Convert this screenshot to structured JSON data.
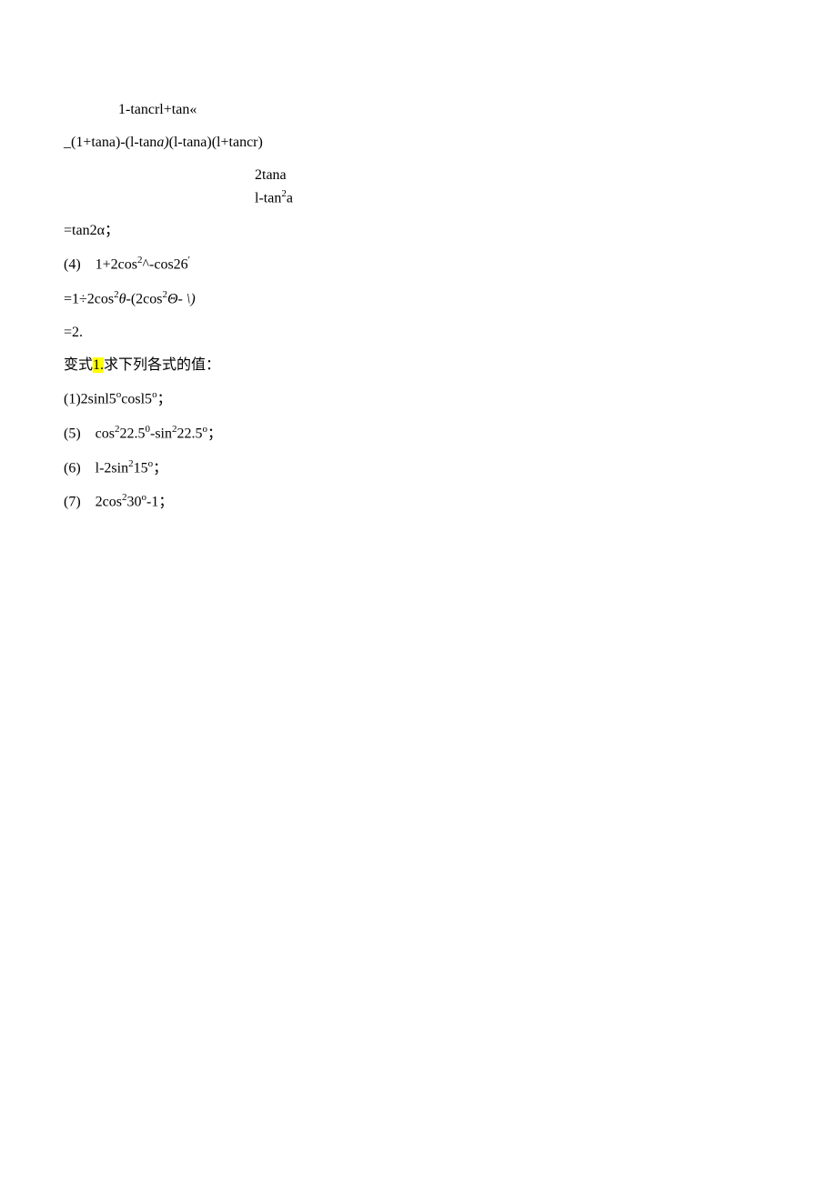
{
  "lines": {
    "l1": "1-tancrl+tan«",
    "l2_pre": "_(1+tana)-(l-tan",
    "l2_a": "a)",
    "l2_post": "(l-tana)(l+tancr)",
    "l3": "2tana",
    "l4a": "l-tan",
    "l4b": "2",
    "l4c": "a",
    "l5": "=tan2α；",
    "l6a": "(4)    1+2cos",
    "l6b": "2",
    "l6c": "^-cos26",
    "l6d": "'",
    "l7a": "=1÷2cos",
    "l7b": "2",
    "l7c": "θ",
    "l7d": "-(2cos",
    "l7e": "2",
    "l7f": "Θ-",
    "l7g": " \\)",
    "l8": "=2.",
    "l9a": "变式",
    "l9b": "1.",
    "l9c": "求下列各式的值：",
    "l10a": "(1)2sinl5",
    "l10b": "o",
    "l10c": "cosl5",
    "l10d": "o",
    "l10e": "；",
    "l11a": "(5)    cos",
    "l11b": "2",
    "l11c": "22.5",
    "l11d": "0",
    "l11e": "-sin",
    "l11f": "2",
    "l11g": "22.5",
    "l11h": "o",
    "l11i": "；",
    "l12a": "(6)    l-2sin",
    "l12b": "2",
    "l12c": "15",
    "l12d": "o",
    "l12e": "；",
    "l13a": "(7)    2cos",
    "l13b": "2",
    "l13c": "30",
    "l13d": "o",
    "l13e": "-1；"
  }
}
